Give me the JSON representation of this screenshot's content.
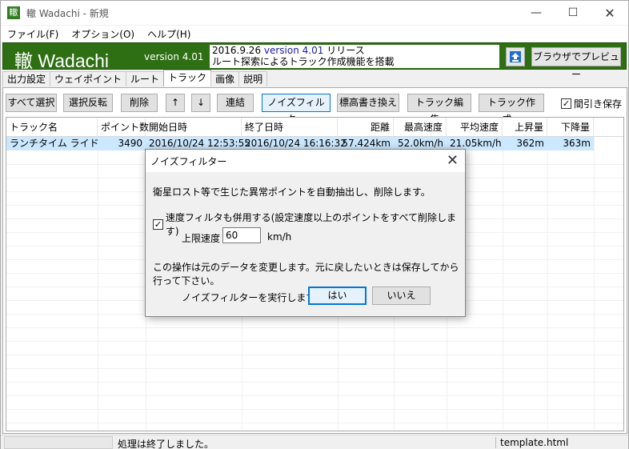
{
  "window": {
    "title": "轍 Wadachi - 新規",
    "icon_glyph": "轍",
    "controls": {
      "minimize": "—",
      "maximize": "☐",
      "close": "✕"
    }
  },
  "menu": [
    "ファイル(F)",
    "オプション(O)",
    "ヘルプ(H)"
  ],
  "banner": {
    "title": "轍 Wadachi",
    "version": "version 4.01",
    "news_line1_prefix": "2016.9.26 ",
    "news_line1_version": "version 4.01",
    "news_line1_suffix": " リリース",
    "news_line2": "ルート探索によるトラック作成機能を搭載",
    "preview_button": "ブラウザでプレビュー",
    "colors": {
      "banner_bg": "#2f6f14",
      "news_version": "#1a1aa8"
    }
  },
  "tabs": [
    "出力設定",
    "ウェイポイント",
    "ルート",
    "トラック",
    "画像",
    "説明"
  ],
  "active_tab": "トラック",
  "toolbar": {
    "select_all": "すべて選択",
    "invert_selection": "選択反転",
    "delete": "削除",
    "move_up": "↑",
    "move_down": "↓",
    "join": "連結",
    "noise_filter": "ノイズフィルタ...",
    "rewrite_elevation": "標高書き換え",
    "edit_track": "トラック編集...",
    "create_track": "トラック作成...",
    "thinning_save": "間引き保存",
    "thinning_save_checked": true
  },
  "list": {
    "columns": [
      "トラック名",
      "ポイント数",
      "開始日時",
      "終了日時",
      "距離",
      "最高速度",
      "平均速度",
      "上昇量",
      "下降量"
    ],
    "rows": [
      {
        "name": "ランチタイム ライド",
        "points": "3490",
        "start": "2016/10/24 12:53:55",
        "end": "2016/10/24 16:16:32",
        "distance": "57.424km",
        "max_speed": "52.0km/h",
        "avg_speed": "21.05km/h",
        "ascent": "362m",
        "descent": "363m"
      }
    ]
  },
  "status": {
    "message": "処理は終了しました。",
    "file": "template.html"
  },
  "dialog": {
    "title": "ノイズフィルター",
    "message": "衛星ロスト等で生じた異常ポイントを自動抽出し、削除します。",
    "speed_filter_label": "速度フィルタも併用する(設定速度以上のポイントをすべて削除します)",
    "speed_filter_checked": true,
    "limit_label": "上限速度",
    "limit_value": "60",
    "limit_unit": "km/h",
    "note": "この操作は元のデータを変更します。元に戻したいときは保存してから行って下さい。",
    "question": "ノイズフィルターを実行しますか？",
    "yes_button": "はい",
    "no_button": "いいえ",
    "close_glyph": "✕"
  }
}
